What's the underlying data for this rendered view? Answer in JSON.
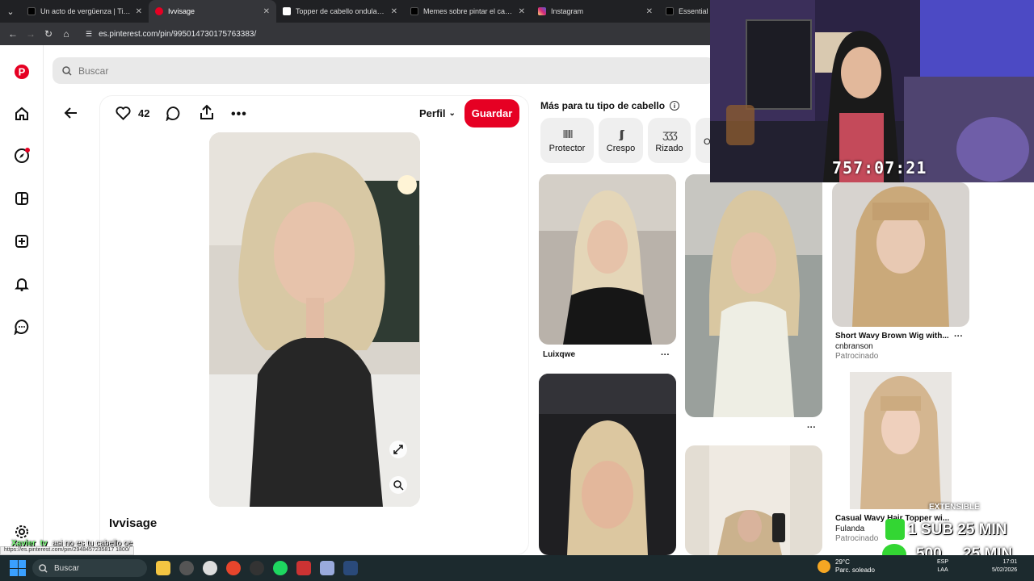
{
  "browser": {
    "tabs": [
      {
        "title": "Un acto de vergüenza | TikTok",
        "fav_color": "#000000"
      },
      {
        "title": "Ivvisage",
        "fav_color": "#e60023",
        "active": true
      },
      {
        "title": "Topper de cabello ondulado in",
        "fav_color": "#ffffff"
      },
      {
        "title": "Memes sobre pintar el cabello",
        "fav_color": "#000000"
      },
      {
        "title": "Instagram",
        "fav_color": "#d6249f"
      },
      {
        "title": "Essential F",
        "fav_color": "#000000"
      }
    ],
    "url": "es.pinterest.com/pin/995014730175763383/"
  },
  "search": {
    "placeholder": "Buscar"
  },
  "pin": {
    "likes": "42",
    "profile_label": "Perfil",
    "save_label": "Guardar",
    "author": "Ivvisage"
  },
  "related": {
    "title": "Más para tu tipo de cabello",
    "hair_types": [
      {
        "label": "Protector",
        "icon": "ǁǁǁ"
      },
      {
        "label": "Crespo",
        "icon": "ʃʃʃ"
      },
      {
        "label": "Rizado",
        "icon": "ӡӡӡ"
      },
      {
        "label": "O",
        "icon": ""
      }
    ],
    "pins": [
      {
        "author": "Luixqwe"
      },
      {
        "title": "Short Wavy Brown Wig with...",
        "author": "cnbranson",
        "tag": "Patrocinado"
      },
      {
        "title": "Casual Wavy Hair Topper wi...",
        "author": "Fulanda",
        "tag": "Patrocinado"
      }
    ]
  },
  "stream": {
    "timer": "757:07:21",
    "extensible": "EXTENSIBLE",
    "goal1": "1 SUB 25 MIN",
    "goal2": "500",
    "goal2b": "25 MIN",
    "chat_user": "Xavier_tv",
    "chat_msg": "asi no es tu cabello oe"
  },
  "status_url": "https://es.pinterest.com/pin/2948457235817 1800/",
  "taskbar": {
    "search_placeholder": "Buscar",
    "temp": "29°C",
    "weather": "Parc. soleado",
    "lang1": "ESP",
    "lang2": "LAA",
    "time": "17:01",
    "date": "5/02/2026"
  }
}
